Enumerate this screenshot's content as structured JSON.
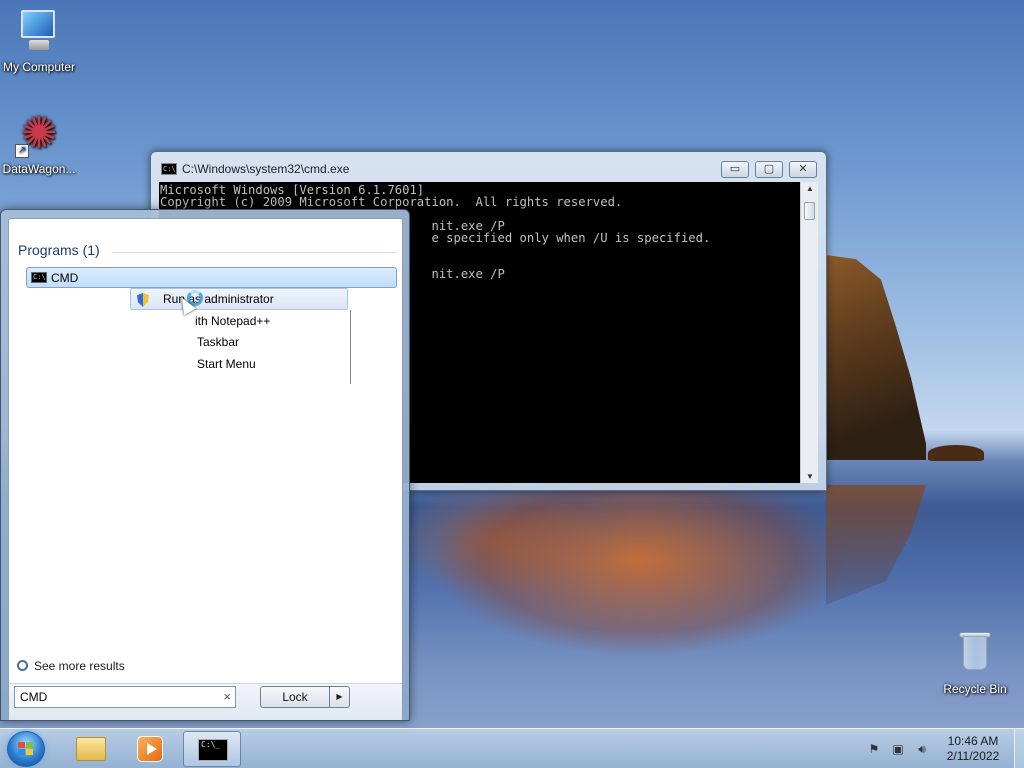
{
  "desktop": {
    "icons": [
      {
        "label": "My Computer"
      },
      {
        "label": "DataWagon..."
      },
      {
        "label": "Recycle Bin"
      }
    ]
  },
  "cmd_window": {
    "title": "C:\\Windows\\system32\\cmd.exe",
    "icon_text": "C:\\.",
    "buttons": {
      "minimize": "▭",
      "maximize": "▢",
      "close": "✕"
    },
    "lines": [
      "Microsoft Windows [Version 6.1.7601]",
      "Copyright (c) 2009 Microsoft Corporation.  All rights reserved.",
      "",
      "                                     nit.exe /P",
      "                                     e specified only when /U is specified.",
      "",
      "",
      "                                     nit.exe /P"
    ]
  },
  "start_menu": {
    "programs_heading": "Programs (1)",
    "result": {
      "label": "CMD",
      "icon_text": "C:\\."
    },
    "context_menu": {
      "items": [
        "Run as administrator",
        "ith Notepad++",
        "Taskbar",
        "Start Menu"
      ]
    },
    "see_more": "See more results",
    "search": {
      "value": "CMD",
      "clear_icon": "×"
    },
    "lock_label": "Lock",
    "lock_arrow": "▶"
  },
  "taskbar": {
    "console_text": "C:\\_",
    "clock": {
      "time": "10:46 AM",
      "date": "2/11/2022"
    },
    "tray_icons": [
      "action-center-icon",
      "network-icon",
      "volume-icon"
    ]
  }
}
